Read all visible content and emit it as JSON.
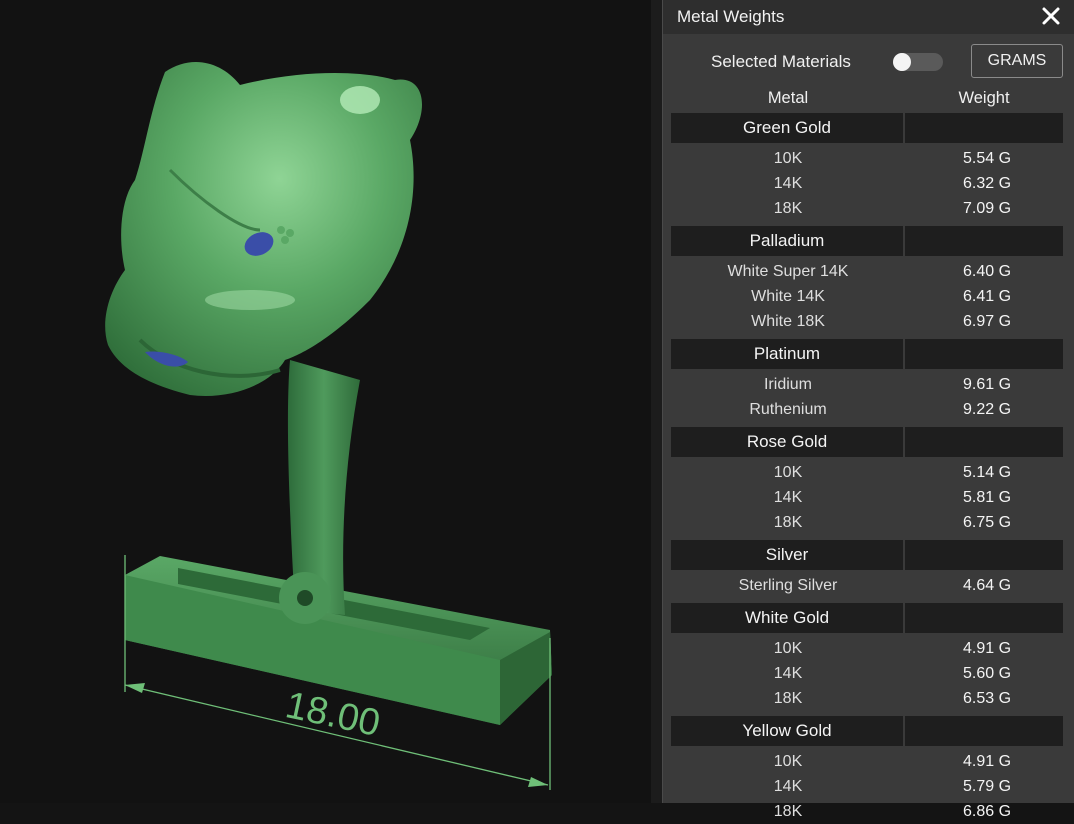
{
  "viewport": {
    "dimension_label": "18.00",
    "model_color": "#4f9a5c",
    "gem_color": "#3a4ea8"
  },
  "panel": {
    "title": "Metal Weights",
    "close_icon": "close-icon",
    "selected_materials_label": "Selected Materials",
    "selected_materials_on": false,
    "unit_button_label": "GRAMS",
    "columns": {
      "metal": "Metal",
      "weight": "Weight"
    },
    "groups": [
      {
        "name": "Green Gold",
        "items": [
          {
            "metal": "10K",
            "weight": "5.54 G"
          },
          {
            "metal": "14K",
            "weight": "6.32 G"
          },
          {
            "metal": "18K",
            "weight": "7.09 G"
          }
        ]
      },
      {
        "name": "Palladium",
        "items": [
          {
            "metal": "White Super 14K",
            "weight": "6.40 G"
          },
          {
            "metal": "White 14K",
            "weight": "6.41 G"
          },
          {
            "metal": "White 18K",
            "weight": "6.97 G"
          }
        ]
      },
      {
        "name": "Platinum",
        "items": [
          {
            "metal": "Iridium",
            "weight": "9.61 G"
          },
          {
            "metal": "Ruthenium",
            "weight": "9.22 G"
          }
        ]
      },
      {
        "name": "Rose Gold",
        "items": [
          {
            "metal": "10K",
            "weight": "5.14 G"
          },
          {
            "metal": "14K",
            "weight": "5.81 G"
          },
          {
            "metal": "18K",
            "weight": "6.75 G"
          }
        ]
      },
      {
        "name": "Silver",
        "items": [
          {
            "metal": "Sterling Silver",
            "weight": "4.64 G"
          }
        ]
      },
      {
        "name": "White Gold",
        "items": [
          {
            "metal": "10K",
            "weight": "4.91 G"
          },
          {
            "metal": "14K",
            "weight": "5.60 G"
          },
          {
            "metal": "18K",
            "weight": "6.53 G"
          }
        ]
      },
      {
        "name": "Yellow Gold",
        "items": [
          {
            "metal": "10K",
            "weight": "4.91 G"
          },
          {
            "metal": "14K",
            "weight": "5.79 G"
          },
          {
            "metal": "18K",
            "weight": "6.86 G"
          }
        ]
      }
    ]
  }
}
